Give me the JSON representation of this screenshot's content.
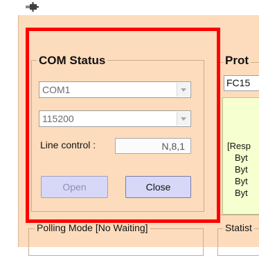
{
  "window": {
    "icon": "app-plug-icon"
  },
  "com_status": {
    "title": "COM Status",
    "port_value": "COM1",
    "baud_value": "115200",
    "line_control_label": "Line control :",
    "line_control_value": "N,8,1",
    "open_label": "Open",
    "close_label": "Close"
  },
  "protocol": {
    "title": "Prot",
    "function_value": "FC15",
    "response_lines": [
      "[Resp",
      "Byt",
      "Byt",
      "Byt",
      "Byt"
    ]
  },
  "polling": {
    "title": "Polling Mode [No Waiting]"
  },
  "statistics": {
    "title": "Statist"
  },
  "highlight": {
    "color": "#ff0000"
  }
}
